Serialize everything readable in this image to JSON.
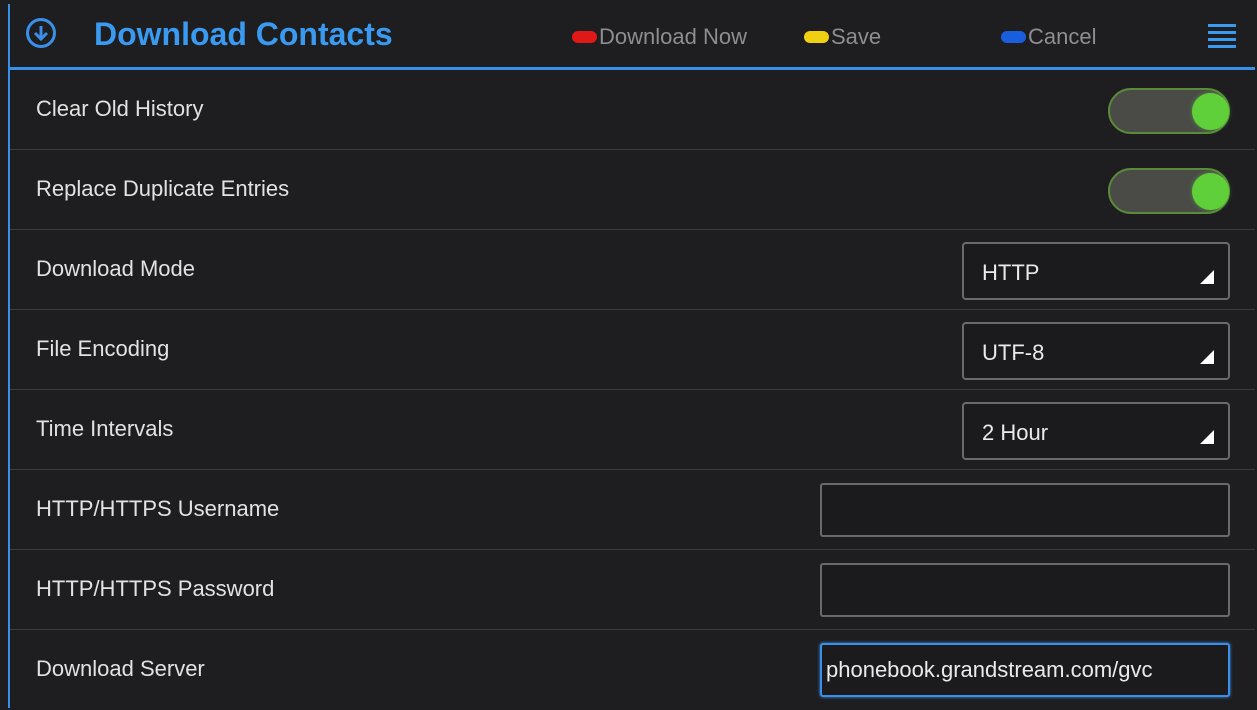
{
  "header": {
    "title": "Download Contacts",
    "title_icon": "download-circle-icon",
    "menu_icon": "menu-icon"
  },
  "softkeys": [
    {
      "label": "Download Now",
      "color": "#e01818"
    },
    {
      "label": "Save",
      "color": "#f0d010"
    },
    {
      "label": "Cancel",
      "color": "#1a5ee0"
    }
  ],
  "settings": {
    "clear_old_history": {
      "label": "Clear Old History",
      "enabled": true
    },
    "replace_duplicate": {
      "label": "Replace Duplicate Entries",
      "enabled": true
    },
    "download_mode": {
      "label": "Download Mode",
      "value": "HTTP"
    },
    "file_encoding": {
      "label": "File Encoding",
      "value": "UTF-8"
    },
    "time_intervals": {
      "label": "Time Intervals",
      "value": "2 Hour"
    },
    "username": {
      "label": "HTTP/HTTPS Username",
      "value": ""
    },
    "password": {
      "label": "HTTP/HTTPS Password",
      "value": ""
    },
    "download_server": {
      "label": "Download Server",
      "value": "phonebook.grandstream.com/gvc"
    }
  },
  "colors": {
    "accent": "#3a8fe8",
    "toggle_on": "#5fd03a",
    "background": "#1e1e20"
  }
}
